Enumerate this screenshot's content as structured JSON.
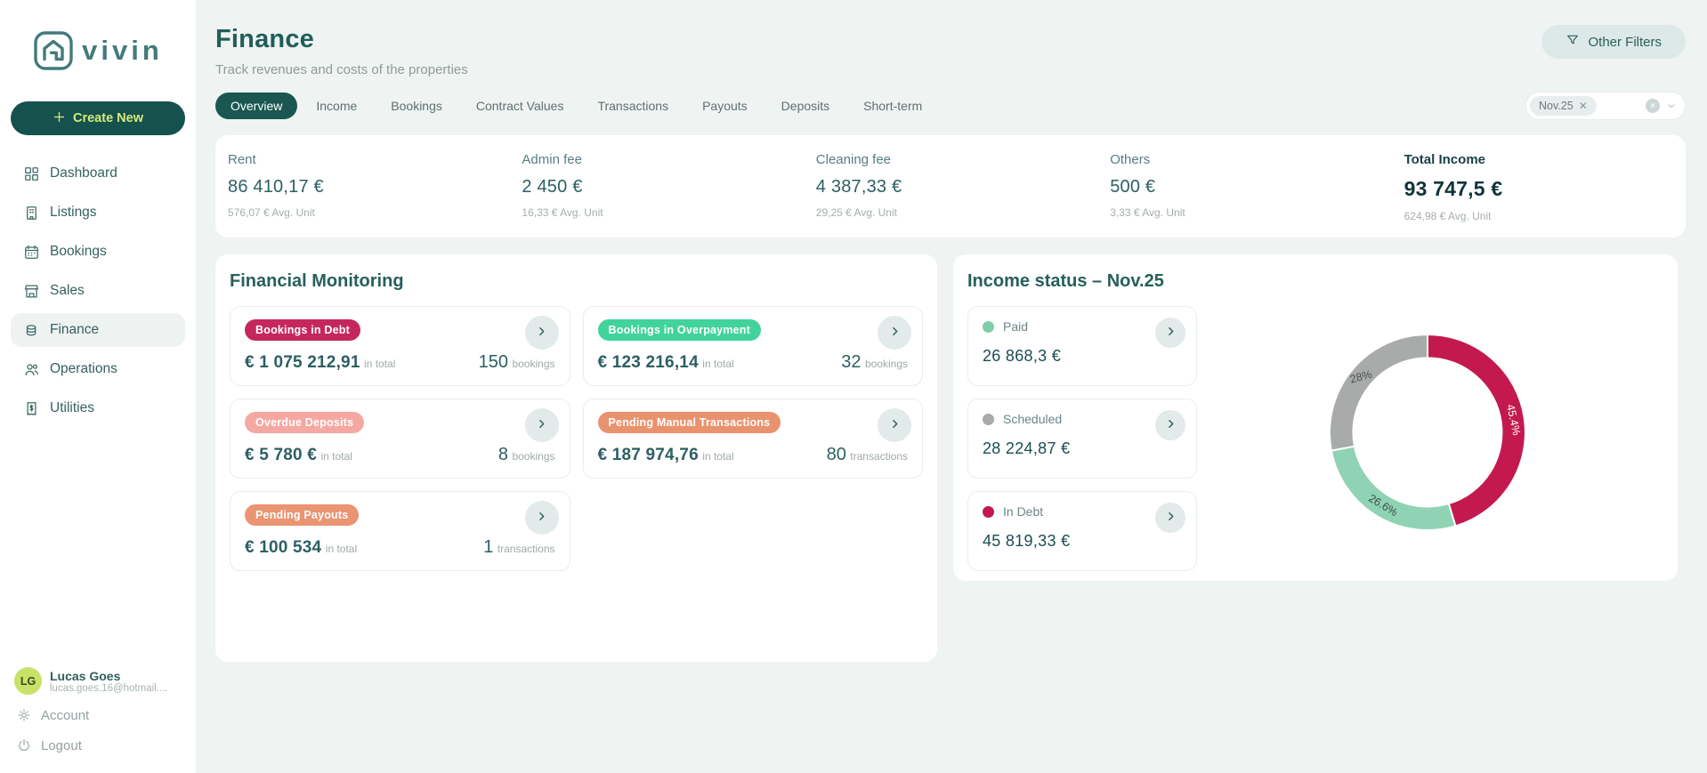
{
  "brand": {
    "name": "vivin"
  },
  "sidebar": {
    "create_button": {
      "label": "Create New"
    },
    "items": [
      {
        "label": "Dashboard",
        "icon": "dashboard-icon",
        "active": false
      },
      {
        "label": "Listings",
        "icon": "listings-icon",
        "active": false
      },
      {
        "label": "Bookings",
        "icon": "bookings-icon",
        "active": false
      },
      {
        "label": "Sales",
        "icon": "sales-icon",
        "active": false
      },
      {
        "label": "Finance",
        "icon": "finance-icon",
        "active": true
      },
      {
        "label": "Operations",
        "icon": "operations-icon",
        "active": false
      },
      {
        "label": "Utilities",
        "icon": "utilities-icon",
        "active": false
      }
    ],
    "user": {
      "initials": "LG",
      "name": "Lucas Goes",
      "email": "lucas.goes.16@hotmail...."
    },
    "account_label": "Account",
    "logout_label": "Logout"
  },
  "header": {
    "title": "Finance",
    "subtitle": "Track revenues and costs of the properties",
    "other_filters_label": "Other Filters"
  },
  "tabs": [
    {
      "label": "Overview",
      "active": true
    },
    {
      "label": "Income",
      "active": false
    },
    {
      "label": "Bookings",
      "active": false
    },
    {
      "label": "Contract Values",
      "active": false
    },
    {
      "label": "Transactions",
      "active": false
    },
    {
      "label": "Payouts",
      "active": false
    },
    {
      "label": "Deposits",
      "active": false
    },
    {
      "label": "Short-term",
      "active": false
    }
  ],
  "filter": {
    "chip": "Nov.25",
    "chip_remove": "✕"
  },
  "stats": [
    {
      "label": "Rent",
      "value": "86 410,17 €",
      "avg": "576,07 € Avg. Unit",
      "emphasis": false
    },
    {
      "label": "Admin fee",
      "value": "2 450 €",
      "avg": "16,33 € Avg. Unit",
      "emphasis": false
    },
    {
      "label": "Cleaning fee",
      "value": "4 387,33 €",
      "avg": "29,25 € Avg. Unit",
      "emphasis": false
    },
    {
      "label": "Others",
      "value": "500 €",
      "avg": "3,33 € Avg. Unit",
      "emphasis": false
    },
    {
      "label": "Total Income",
      "value": "93 747,5 €",
      "avg": "624,98 € Avg. Unit",
      "emphasis": true
    }
  ],
  "monitoring": {
    "title": "Financial Monitoring",
    "in_total_label": "in total",
    "cards": [
      {
        "badge": "Bookings in Debt",
        "badge_color": "#c5275c",
        "amount": "€ 1 075 212,91",
        "count": "150",
        "count_unit": "bookings"
      },
      {
        "badge": "Bookings in Overpayment",
        "badge_color": "#41d39b",
        "amount": "€ 123 216,14",
        "count": "32",
        "count_unit": "bookings"
      },
      {
        "badge": "Overdue Deposits",
        "badge_color": "#f5a8a1",
        "amount": "€ 5 780 €",
        "count": "8",
        "count_unit": "bookings"
      },
      {
        "badge": "Pending Manual Transactions",
        "badge_color": "#e9926e",
        "amount": "€ 187 974,76",
        "count": "80",
        "count_unit": "transactions"
      },
      {
        "badge": "Pending Payouts",
        "badge_color": "#ea9472",
        "amount": "€ 100 534",
        "count": "1",
        "count_unit": "transactions"
      }
    ]
  },
  "income_status": {
    "title": "Income status – Nov.25",
    "cards": [
      {
        "label": "Paid",
        "color": "#7fceab",
        "value": "26 868,3 €"
      },
      {
        "label": "Scheduled",
        "color": "#a8abaa",
        "value": "28 224,87 €"
      },
      {
        "label": "In Debt",
        "color": "#c3194f",
        "value": "45 819,33 €"
      }
    ]
  },
  "chart_data": {
    "type": "pie",
    "title": "Income status – Nov.25",
    "donut": true,
    "inner_radius_ratio": 0.76,
    "start_angle_deg": 0,
    "direction": "clockwise",
    "labels": [
      "In Debt",
      "Paid",
      "Scheduled"
    ],
    "values": [
      45.4,
      26.6,
      28
    ],
    "value_labels": [
      "45.4%",
      "26.6%",
      "28%"
    ],
    "amounts_eur": [
      "45 819,33 €",
      "26 868,3 €",
      "28 224,87 €"
    ],
    "colors": [
      "#c3194f",
      "#8fd3b4",
      "#a8abaa"
    ],
    "label_colors": [
      "#ffffff",
      "#3f4a4a",
      "#4a5050"
    ],
    "label_rotations_deg": [
      78,
      31,
      -15
    ],
    "legend_position": "left-cards"
  }
}
